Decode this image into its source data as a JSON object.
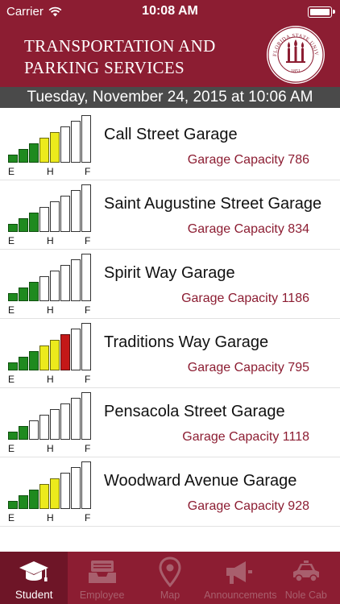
{
  "status_bar": {
    "carrier": "Carrier",
    "time": "10:08 AM"
  },
  "header": {
    "title": "TRANSPORTATION AND PARKING SERVICES",
    "seal_text": "FLORIDA STATE UNIVERSITY",
    "seal_year": "1851"
  },
  "date_bar": {
    "text": "Tuesday, November 24, 2015 at 10:06 AM"
  },
  "meter_labels": {
    "empty": "E",
    "half": "H",
    "full": "F"
  },
  "colors": {
    "garnet": "#8c1d32",
    "green": "#1f8a1f",
    "yellow": "#ecea1c",
    "red": "#c41818"
  },
  "garages": [
    {
      "name": "Call Street Garage",
      "capacity_text": "Garage Capacity 786",
      "bars": [
        "green",
        "green",
        "green",
        "yellow",
        "yellow",
        "empty",
        "empty",
        "empty"
      ]
    },
    {
      "name": "Saint Augustine Street Garage",
      "capacity_text": "Garage Capacity 834",
      "bars": [
        "green",
        "green",
        "green",
        "empty",
        "empty",
        "empty",
        "empty",
        "empty"
      ]
    },
    {
      "name": "Spirit Way Garage",
      "capacity_text": "Garage Capacity 1186",
      "bars": [
        "green",
        "green",
        "green",
        "empty",
        "empty",
        "empty",
        "empty",
        "empty"
      ]
    },
    {
      "name": "Traditions Way Garage",
      "capacity_text": "Garage Capacity 795",
      "bars": [
        "green",
        "green",
        "green",
        "yellow",
        "yellow",
        "red",
        "empty",
        "empty"
      ]
    },
    {
      "name": "Pensacola Street Garage",
      "capacity_text": "Garage Capacity 1118",
      "bars": [
        "green",
        "green",
        "empty",
        "empty",
        "empty",
        "empty",
        "empty",
        "empty"
      ]
    },
    {
      "name": "Woodward Avenue Garage",
      "capacity_text": "Garage Capacity 928",
      "bars": [
        "green",
        "green",
        "green",
        "yellow",
        "yellow",
        "empty",
        "empty",
        "empty"
      ]
    }
  ],
  "tabs": [
    {
      "label": "Student",
      "icon": "graduation-cap-icon",
      "active": true
    },
    {
      "label": "Employee",
      "icon": "inbox-tray-icon",
      "active": false
    },
    {
      "label": "Map",
      "icon": "map-pin-icon",
      "active": false
    },
    {
      "label": "Announcements",
      "icon": "megaphone-icon",
      "active": false
    },
    {
      "label": "Nole Cab",
      "icon": "car-icon",
      "active": false
    }
  ]
}
